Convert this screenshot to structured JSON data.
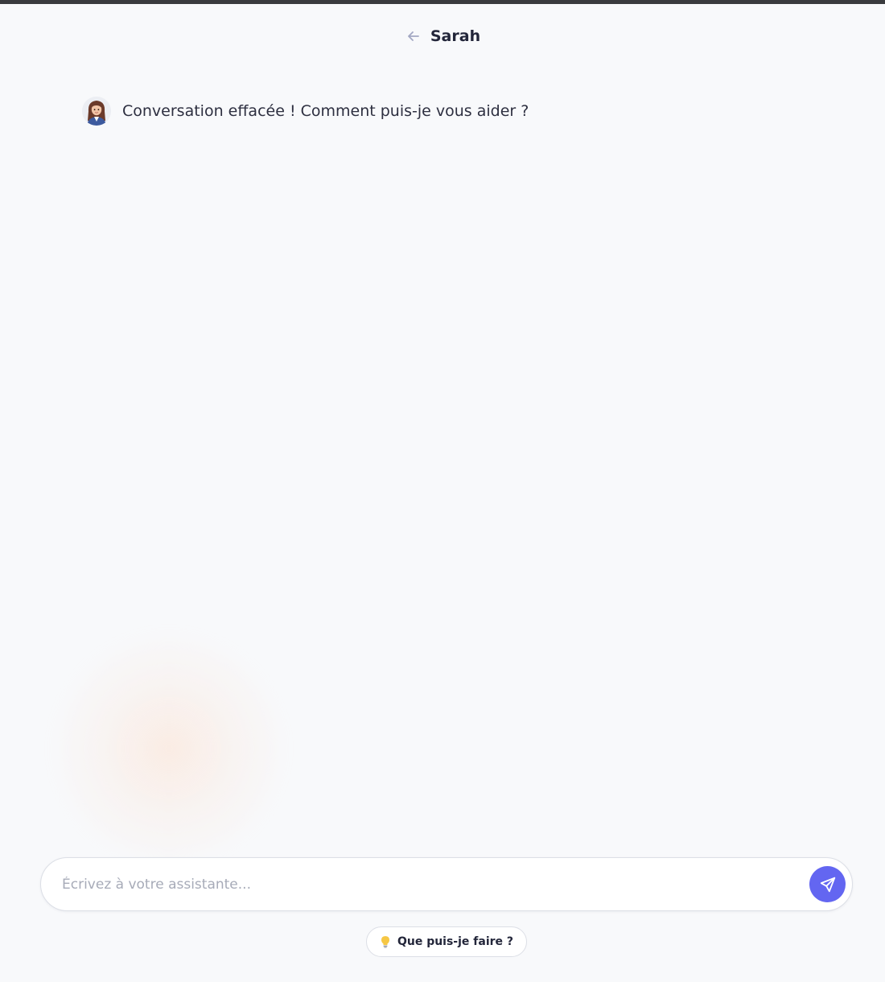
{
  "header": {
    "title": "Sarah",
    "back_icon": "arrow-left-icon"
  },
  "messages": [
    {
      "sender": "assistant",
      "avatar_icon": "assistant-avatar",
      "text": "Conversation effacée ! Comment puis-je vous aider ?"
    }
  ],
  "composer": {
    "placeholder": "Écrivez à votre assistante...",
    "value": "",
    "send_icon": "send-icon"
  },
  "suggestion": {
    "icon": "lightbulb-icon",
    "label": "Que puis-je faire ?"
  },
  "colors": {
    "accent": "#6366f1",
    "background": "#f8f9fb",
    "text": "#2d2f40"
  }
}
